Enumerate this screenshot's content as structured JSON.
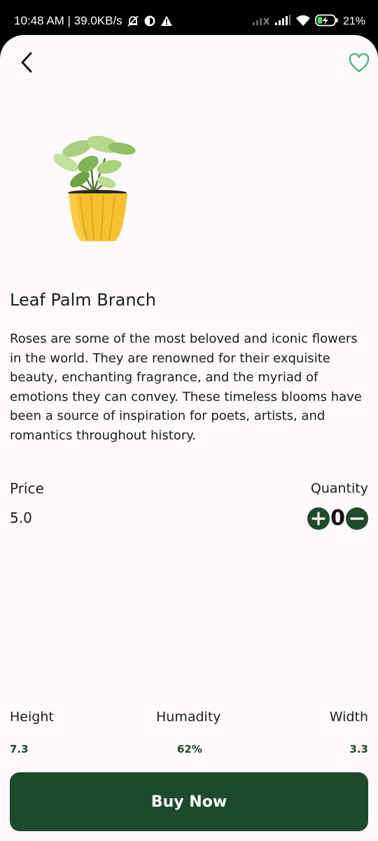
{
  "status_bar": {
    "time_speed": "10:48 AM | 39.0KB/s",
    "battery": "21%"
  },
  "header": {
    "back_icon": "chevron-left-icon",
    "favorite_icon": "heart-outline-icon"
  },
  "product": {
    "image_icon": "potted-plant-image",
    "name": "Leaf Palm Branch",
    "description": "Roses are some of the most beloved and iconic flowers in the world. They are renowned for their exquisite beauty, enchanting fragrance, and the myriad of emotions they can convey. These timeless blooms have been a source of inspiration for poets, artists, and romantics throughout history.",
    "price_label": "Price",
    "price_value": "5.0",
    "quantity_label": "Quantity",
    "quantity_value": "0"
  },
  "specs": {
    "height_label": "Height",
    "height_value": "7.3",
    "humidity_label": "Humadity",
    "humidity_value": "62%",
    "width_label": "Width",
    "width_value": "3.3"
  },
  "action": {
    "buy_label": "Buy Now"
  },
  "colors": {
    "accent": "#1d4a2c",
    "background": "#fdf9fd",
    "favorite": "#4caf6a",
    "pot": "#f5c12e"
  }
}
